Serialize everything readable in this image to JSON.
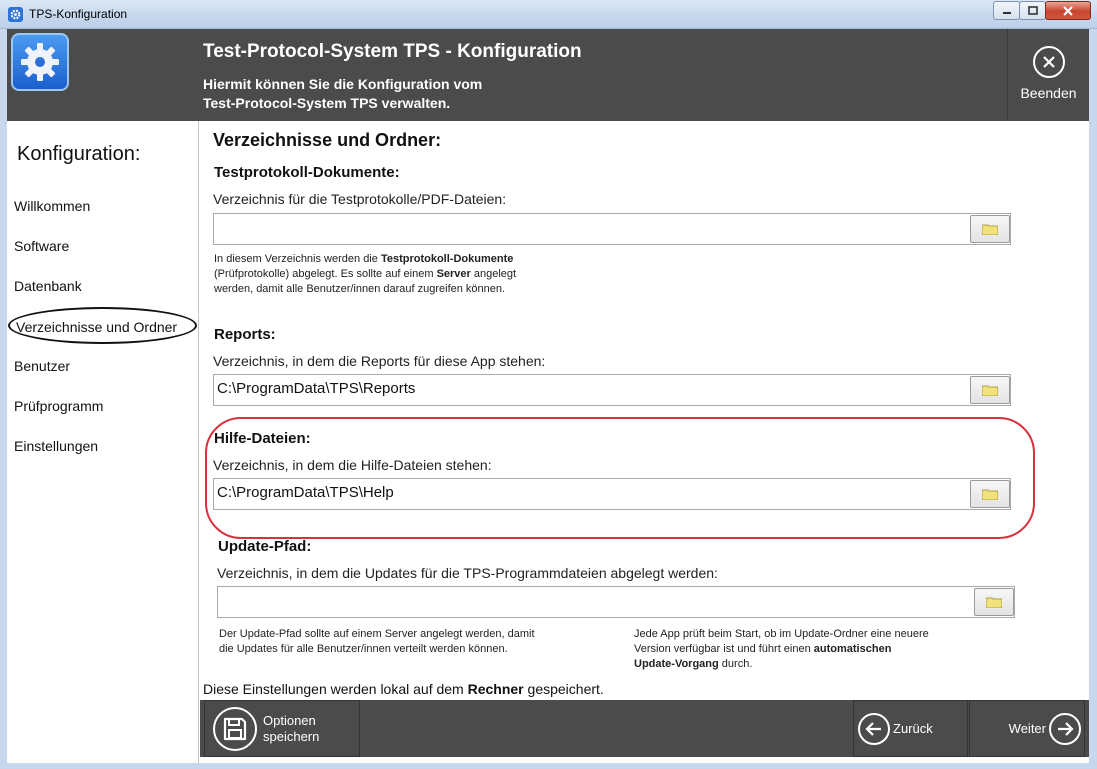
{
  "window": {
    "title": "TPS-Konfiguration"
  },
  "header": {
    "title": "Test-Protocol-System TPS - Konfiguration",
    "desc_line1": "Hiermit können Sie die Konfiguration vom",
    "desc_line2": "Test-Protocol-System TPS verwalten.",
    "exit_label": "Beenden"
  },
  "sidebar": {
    "heading": "Konfiguration:",
    "items": [
      {
        "label": "Willkommen"
      },
      {
        "label": "Software"
      },
      {
        "label": "Datenbank"
      },
      {
        "label": "Verzeichnisse und Ordner"
      },
      {
        "label": "Benutzer"
      },
      {
        "label": "Prüfprogramm"
      },
      {
        "label": "Einstellungen"
      }
    ]
  },
  "main": {
    "section_title": "Verzeichnisse und Ordner:",
    "testprotokoll": {
      "heading": "Testprotokoll-Dokumente:",
      "label": "Verzeichnis für die Testprotokolle/PDF-Dateien:",
      "value": "",
      "note_parts": [
        "In diesem Verzeichnis werden die ",
        "Testprotokoll-Dokumente",
        "(Prüfprotokolle) abgelegt. Es sollte auf einem ",
        "Server",
        " angelegt",
        "werden, damit alle Benutzer/innen darauf zugreifen können."
      ]
    },
    "reports": {
      "heading": "Reports:",
      "label": "Verzeichnis, in dem die Reports für diese App stehen:",
      "value": "C:\\ProgramData\\TPS\\Reports"
    },
    "help": {
      "heading": "Hilfe-Dateien:",
      "label": "Verzeichnis, in dem die Hilfe-Dateien stehen:",
      "value": "C:\\ProgramData\\TPS\\Help"
    },
    "update": {
      "heading": "Update-Pfad:",
      "label": "Verzeichnis, in dem die Updates für die TPS-Programmdateien abgelegt werden:",
      "value": "",
      "note_left_1": "Der Update-Pfad sollte auf einem Server angelegt werden, damit",
      "note_left_2": "die Updates für alle Benutzer/innen verteilt werden können.",
      "note_right_1": "Jede App prüft beim Start, ob im Update-Ordner eine neuere",
      "note_right_2": "Version verfügbar ist und führt einen ",
      "note_right_bold": "automatischen",
      "note_right_3_bold": "Update-Vorgang",
      "note_right_3": " durch."
    },
    "footer_parts": [
      "Diese Einstellungen werden lokal auf dem ",
      "Rechner",
      " gespeichert."
    ]
  },
  "toolbar": {
    "save_line1": "Optionen",
    "save_line2": "speichern",
    "back_label": "Zurück",
    "next_label": "Weiter"
  },
  "colors": {
    "header_bg": "#4b4b4b",
    "highlight": "#d5323c",
    "frame": "#c7d8ee"
  }
}
